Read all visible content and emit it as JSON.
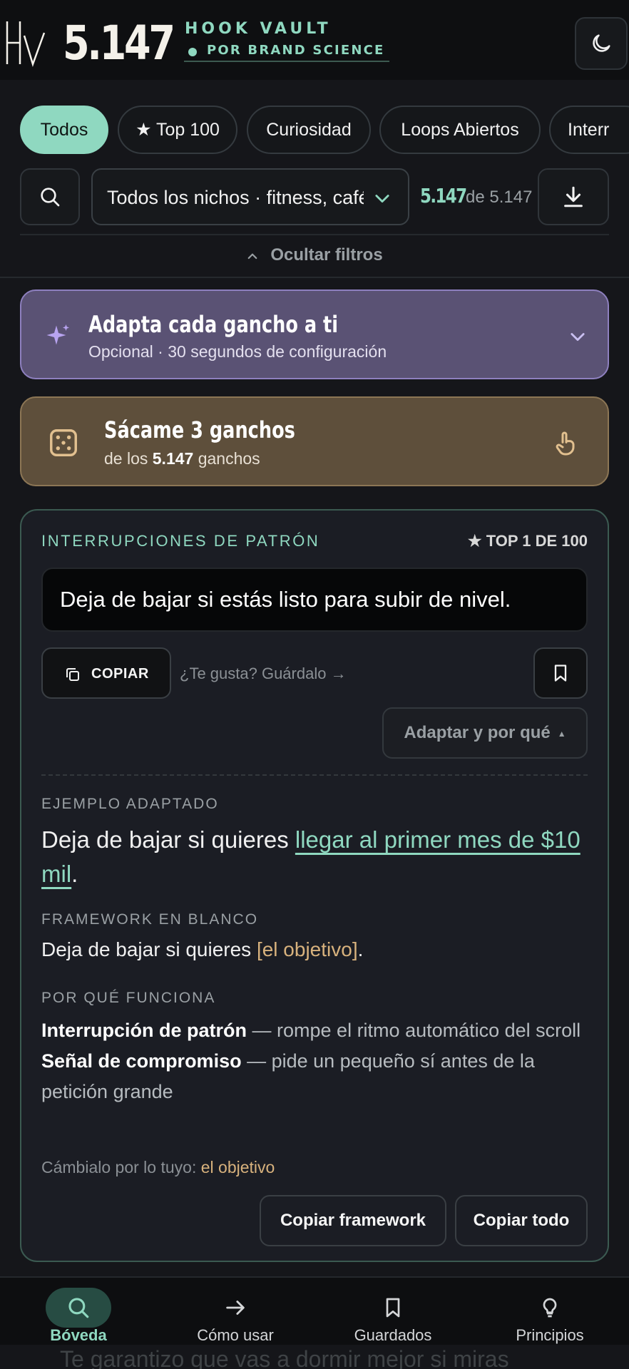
{
  "header": {
    "total_count": "5.147",
    "brand_name": "HOOK VAULT",
    "brand_subtitle": "POR BRAND SCIENCE",
    "logo_icon": "hv-monogram-icon",
    "theme_icon": "moon-icon"
  },
  "chips": [
    {
      "label": "Todos",
      "active": true
    },
    {
      "label": "★ Top 100",
      "active": false
    },
    {
      "label": "Curiosidad",
      "active": false
    },
    {
      "label": "Loops Abiertos",
      "active": false
    },
    {
      "label": "Interr",
      "active": false
    }
  ],
  "filters": {
    "niche_value": "Todos los nichos · fitness, café",
    "result_count": "5.147",
    "result_total": "de 5.147",
    "hide_label": "Ocultar filtros"
  },
  "adapt_card": {
    "title": "Adapta cada gancho a ti",
    "subtitle": "Opcional · 30 segundos de configuración"
  },
  "random_card": {
    "title": "Sácame 3 ganchos",
    "sub_prefix": "de los",
    "sub_count": "5.147",
    "sub_suffix": "ganchos"
  },
  "hook_card": {
    "category": "INTERRUPCIONES DE PATRÓN",
    "rank": "★ TOP 1 DE 100",
    "hook_text": "Deja de bajar si estás listo para subir de nivel.",
    "copy_label": "COPIAR",
    "save_hint": "¿Te gusta? Guárdalo →",
    "adapt_why_label": "Adaptar y por qué",
    "example_label": "EJEMPLO ADAPTADO",
    "example_prefix": "Deja de bajar si quieres ",
    "example_highlight": "llegar al primer mes de $10 mil",
    "example_suffix": ".",
    "framework_label": "FRAMEWORK EN BLANCO",
    "framework_prefix": "Deja de bajar si quieres ",
    "framework_placeholder": "[el objetivo]",
    "framework_suffix": ".",
    "why_label": "POR QUÉ FUNCIONA",
    "reasons": [
      {
        "name": "Interrupción de patrón",
        "desc": " — rompe el ritmo automático del scroll"
      },
      {
        "name": "Señal de compromiso",
        "desc": " — pide un pequeño sí antes de la petición grande"
      }
    ],
    "swap_prefix": "Cámbialo por lo tuyo: ",
    "swap_placeholder": "el objetivo",
    "copy_framework_label": "Copiar framework",
    "copy_all_label": "Copiar todo"
  },
  "peek_text": "Te garantizo que vas a dormir mejor si miras",
  "bottom_nav": [
    {
      "label": "Bóveda",
      "icon": "search-icon",
      "active": true
    },
    {
      "label": "Cómo usar",
      "icon": "arrow-right-icon",
      "active": false
    },
    {
      "label": "Guardados",
      "icon": "bookmark-icon",
      "active": false
    },
    {
      "label": "Principios",
      "icon": "lightbulb-icon",
      "active": false
    }
  ],
  "colors": {
    "accent": "#8fd8c0",
    "background": "#15161a",
    "adapt_card": "#5a5274",
    "random_card": "#5e4f3b",
    "placeholder": "#d8b27d"
  }
}
